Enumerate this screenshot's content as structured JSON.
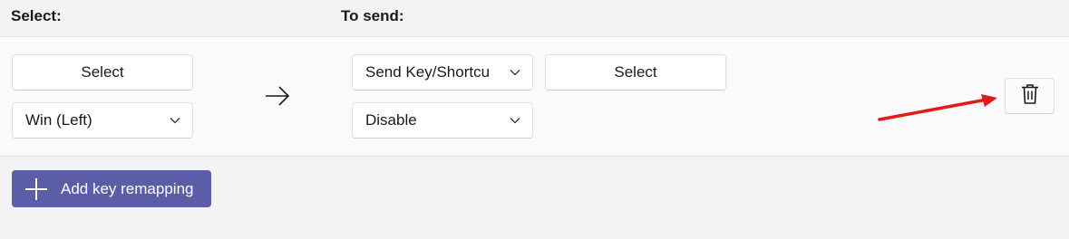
{
  "headers": {
    "select": "Select:",
    "to_send": "To send:"
  },
  "row": {
    "select_button": "Select",
    "original_key": "Win (Left)",
    "send_type": "Send Key/Shortcu",
    "send_select_button": "Select",
    "send_value": "Disable"
  },
  "icons": {
    "mapping_arrow": "right-arrow-icon",
    "delete": "trash-icon",
    "add": "plus-icon",
    "dropdown": "chevron-down-icon"
  },
  "add_button": {
    "label": "Add key remapping"
  },
  "colors": {
    "accent": "#5b5ea6",
    "annotation": "#e01b1b",
    "background": "#f3f3f3",
    "panel": "#fafafa"
  }
}
